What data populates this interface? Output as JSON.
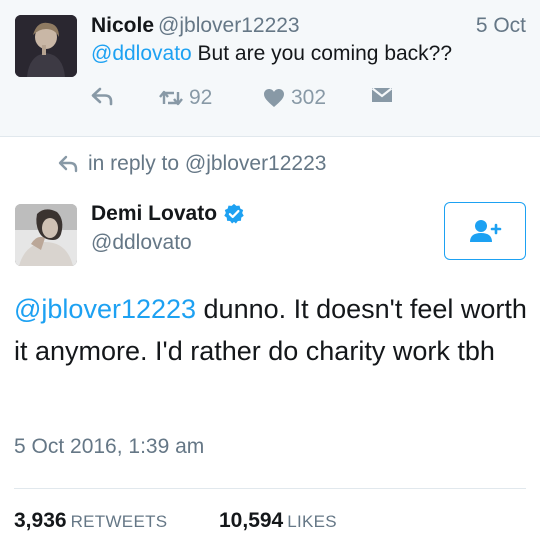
{
  "parent_tweet": {
    "name": "Nicole",
    "handle": "@jblover12223",
    "date": "5 Oct",
    "mention": "@ddlovato",
    "text": " But are you coming back??",
    "retweets": "92",
    "likes": "302"
  },
  "reply_context": {
    "text": "in reply to @jblover12223"
  },
  "main_tweet": {
    "name": "Demi Lovato",
    "handle": "@ddlovato",
    "mention": "@jblover12223",
    "text": " dunno. It doesn't feel worth it anymore. I'd rather do charity work tbh",
    "timestamp": "5 Oct 2016, 1:39 am",
    "retweets_count": "3,936",
    "retweets_label": "RETWEETS",
    "likes_count": "10,594",
    "likes_label": "LIKES"
  },
  "colors": {
    "accent": "#1da1f2",
    "secondary_text": "#657786",
    "icon_gray": "#8899a6"
  }
}
